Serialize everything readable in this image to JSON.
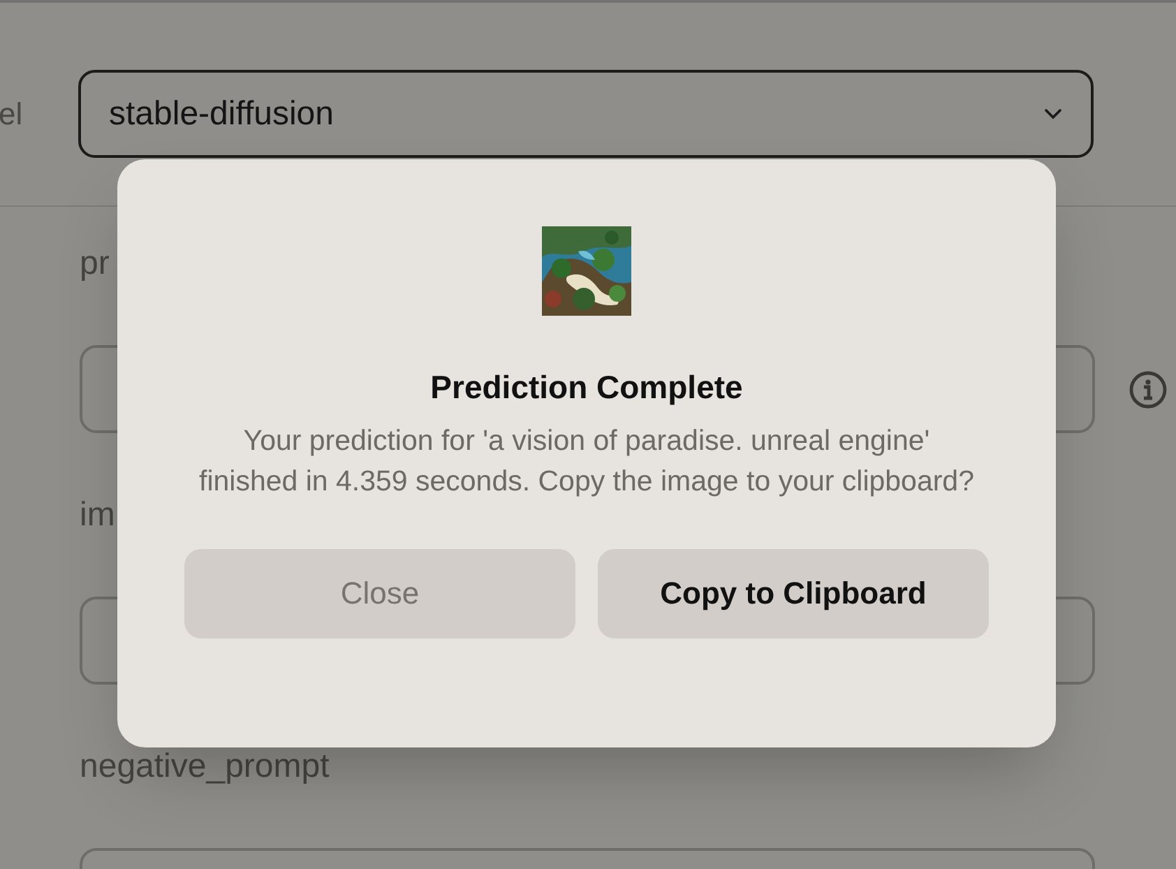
{
  "form": {
    "model": {
      "label": "el",
      "value": "stable-diffusion"
    },
    "fields": [
      {
        "label": "pr",
        "info": true
      },
      {
        "label": "im",
        "info": false
      },
      {
        "label": "negative_prompt",
        "info": false
      }
    ]
  },
  "dialog": {
    "title": "Prediction Complete",
    "message": "Your prediction for 'a vision of paradise. unreal engine' finished in 4.359 seconds. Copy the image to your clipboard?",
    "buttons": [
      {
        "label": "Close",
        "kind": "secondary"
      },
      {
        "label": "Copy to Clipboard",
        "kind": "primary"
      }
    ]
  }
}
